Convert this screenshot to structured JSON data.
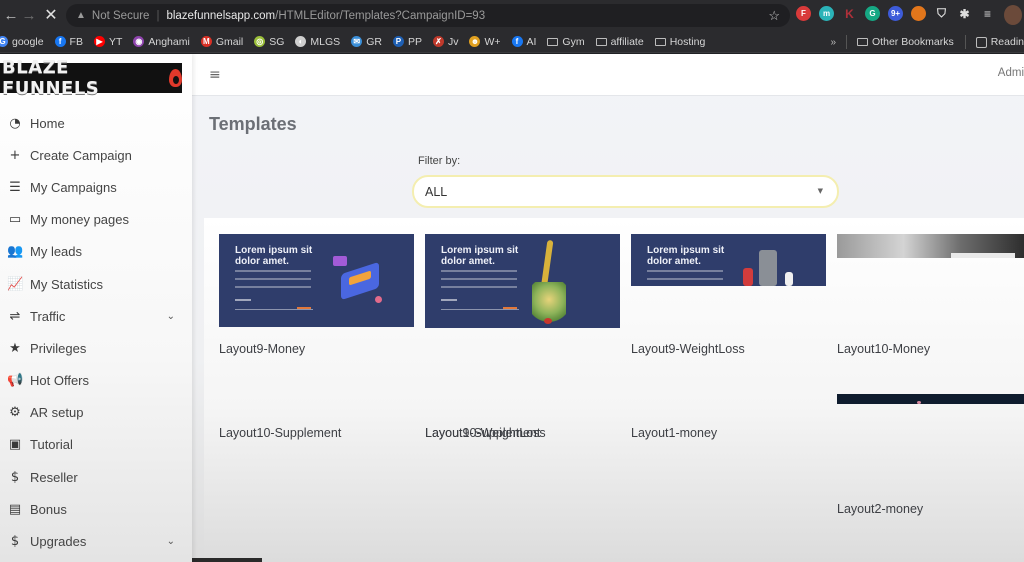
{
  "browser": {
    "url_warning": "Not Secure",
    "url_host": "blazefunnelsapp.com",
    "url_path": "/HTMLEditor/Templates?CampaignID=93",
    "extensions": [
      {
        "name": "ext-red",
        "color": "#d93a3a",
        "glyph": "F"
      },
      {
        "name": "ext-teal",
        "color": "#2bb3b8",
        "glyph": "m"
      },
      {
        "name": "ext-k",
        "color": "transparent",
        "glyph": "K"
      },
      {
        "name": "ext-grammarly",
        "color": "#16a884",
        "glyph": "G"
      },
      {
        "name": "ext-blue",
        "color": "#3d5bd9",
        "glyph": "9+"
      },
      {
        "name": "ext-fox",
        "color": "#e2761b",
        "glyph": ""
      },
      {
        "name": "ext-shield",
        "color": "transparent",
        "glyph": "⛉"
      },
      {
        "name": "ext-puzzle",
        "color": "transparent",
        "glyph": "✱"
      },
      {
        "name": "ext-media",
        "color": "transparent",
        "glyph": "≡"
      }
    ],
    "bookmarks": [
      {
        "label": "google",
        "icon": "google-icon",
        "color": "#4285f4",
        "glyph": "G"
      },
      {
        "label": "FB",
        "icon": "facebook-icon",
        "color": "#1877f2",
        "glyph": "f"
      },
      {
        "label": "YT",
        "icon": "youtube-icon",
        "color": "#ff0000",
        "glyph": "▶"
      },
      {
        "label": "Anghami",
        "icon": "anghami-icon",
        "color": "#8e44ad",
        "glyph": "◉"
      },
      {
        "label": "Gmail",
        "icon": "gmail-icon",
        "color": "#d93025",
        "glyph": "M"
      },
      {
        "label": "SG",
        "icon": "sg-icon",
        "color": "#9bbf3a",
        "glyph": "◎"
      },
      {
        "label": "MLGS",
        "icon": "globe-icon",
        "color": "#cfcfcf",
        "glyph": "◐"
      },
      {
        "label": "GR",
        "icon": "mail-icon",
        "color": "#3b8fd8",
        "glyph": "✉"
      },
      {
        "label": "PP",
        "icon": "paypal-icon",
        "color": "#1e5fb3",
        "glyph": "P"
      },
      {
        "label": "Jv",
        "icon": "jv-icon",
        "color": "#c0392b",
        "glyph": "✗"
      },
      {
        "label": "W+",
        "icon": "w-plus-icon",
        "color": "#e0a020",
        "glyph": "☻"
      },
      {
        "label": "AI",
        "icon": "facebook-icon",
        "color": "#1877f2",
        "glyph": "f"
      },
      {
        "label": "Gym",
        "icon": "folder-icon",
        "color": "",
        "glyph": ""
      },
      {
        "label": "affiliate",
        "icon": "folder-icon",
        "color": "",
        "glyph": ""
      },
      {
        "label": "Hosting",
        "icon": "folder-icon",
        "color": "",
        "glyph": ""
      }
    ],
    "other_bookmarks": "Other Bookmarks",
    "reading_list": "Readin"
  },
  "app": {
    "logo_text": "BLAZE FUNNELS",
    "admin_label": "Admi",
    "sidebar": [
      {
        "label": "Home",
        "icon": "dashboard-icon",
        "glyph": "◔",
        "has_chevron": false
      },
      {
        "label": "Create Campaign",
        "icon": "plus-icon",
        "glyph": "+",
        "has_chevron": false
      },
      {
        "label": "My Campaigns",
        "icon": "list-icon",
        "glyph": "☰",
        "has_chevron": false
      },
      {
        "label": "My money pages",
        "icon": "folder-icon",
        "glyph": "▭",
        "has_chevron": false
      },
      {
        "label": "My leads",
        "icon": "users-icon",
        "glyph": "👥",
        "has_chevron": false
      },
      {
        "label": "My Statistics",
        "icon": "chart-icon",
        "glyph": "📈",
        "has_chevron": false
      },
      {
        "label": "Traffic",
        "icon": "signpost-icon",
        "glyph": "⇌",
        "has_chevron": true
      },
      {
        "label": "Privileges",
        "icon": "star-icon",
        "glyph": "★",
        "has_chevron": false
      },
      {
        "label": "Hot Offers",
        "icon": "megaphone-icon",
        "glyph": "📢",
        "has_chevron": false
      },
      {
        "label": "AR setup",
        "icon": "gears-icon",
        "glyph": "⚙",
        "has_chevron": false
      },
      {
        "label": "Tutorial",
        "icon": "images-icon",
        "glyph": "▣",
        "has_chevron": false
      },
      {
        "label": "Reseller",
        "icon": "hand-dollar-icon",
        "glyph": "$",
        "has_chevron": false
      },
      {
        "label": "Bonus",
        "icon": "money-bill-icon",
        "glyph": "▤",
        "has_chevron": false
      },
      {
        "label": "Upgrades",
        "icon": "hand-dollar-icon",
        "glyph": "$",
        "has_chevron": true
      }
    ],
    "chevron_glyph": "⌄",
    "page_title": "Templates",
    "filter": {
      "label": "Filter by:",
      "selected": "ALL"
    },
    "templates": [
      {
        "label": "Layout9-Money",
        "thumb_title": "Lorem ipsum sit dolor amet.",
        "thumb_kind": "money"
      },
      {
        "label": "Layout9-Supplement",
        "thumb_title": "Lorem ipsum sit dolor amet.",
        "thumb_kind": "supplement"
      },
      {
        "label": "Layout9-WeightLoss",
        "thumb_title": "Lorem ipsum sit dolor amet.",
        "thumb_kind": "weightloss"
      },
      {
        "label": "Layout10-Money",
        "thumb_title": "",
        "thumb_kind": "photo"
      },
      {
        "label": "Layout10-Supplement",
        "thumb_title": "",
        "thumb_kind": "none"
      },
      {
        "label": "Layout10-WeightLoss",
        "thumb_title": "",
        "thumb_kind": "none"
      },
      {
        "label": "Layout1-money",
        "thumb_title": "",
        "thumb_kind": "none"
      },
      {
        "label": "Layout2-money",
        "thumb_title": "",
        "thumb_kind": "dark"
      }
    ]
  }
}
